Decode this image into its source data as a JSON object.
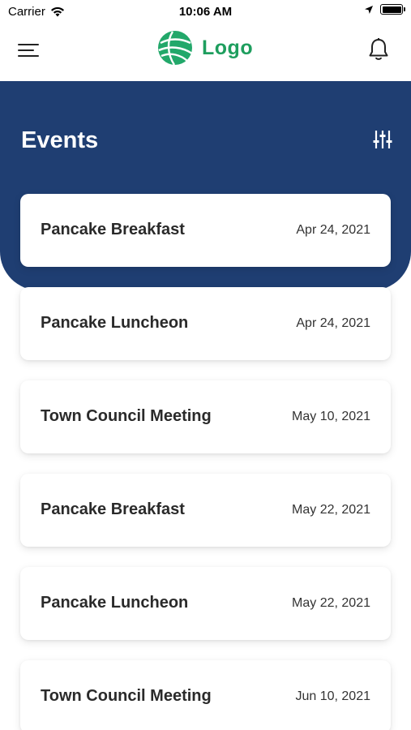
{
  "status_bar": {
    "carrier": "Carrier",
    "time": "10:06 AM",
    "icons": [
      "wifi-icon",
      "location-arrow-icon",
      "battery-icon"
    ]
  },
  "header": {
    "logo_text": "Logo",
    "icons": [
      "hamburger-menu-icon",
      "logo-globe-icon",
      "bell-icon"
    ]
  },
  "hero": {
    "title": "Events",
    "filter_icon": "sliders-icon"
  },
  "events": [
    {
      "name": "Pancake Breakfast",
      "date": "Apr 24, 2021"
    },
    {
      "name": "Pancake Luncheon",
      "date": "Apr 24, 2021"
    },
    {
      "name": "Town Council Meeting",
      "date": "May 10, 2021"
    },
    {
      "name": "Pancake Breakfast",
      "date": "May 22, 2021"
    },
    {
      "name": "Pancake Luncheon",
      "date": "May 22, 2021"
    },
    {
      "name": "Town Council Meeting",
      "date": "Jun 10, 2021"
    }
  ],
  "colors": {
    "hero_background": "#1f3e72",
    "logo_green": "#1e9e5e",
    "card_background": "#ffffff"
  }
}
